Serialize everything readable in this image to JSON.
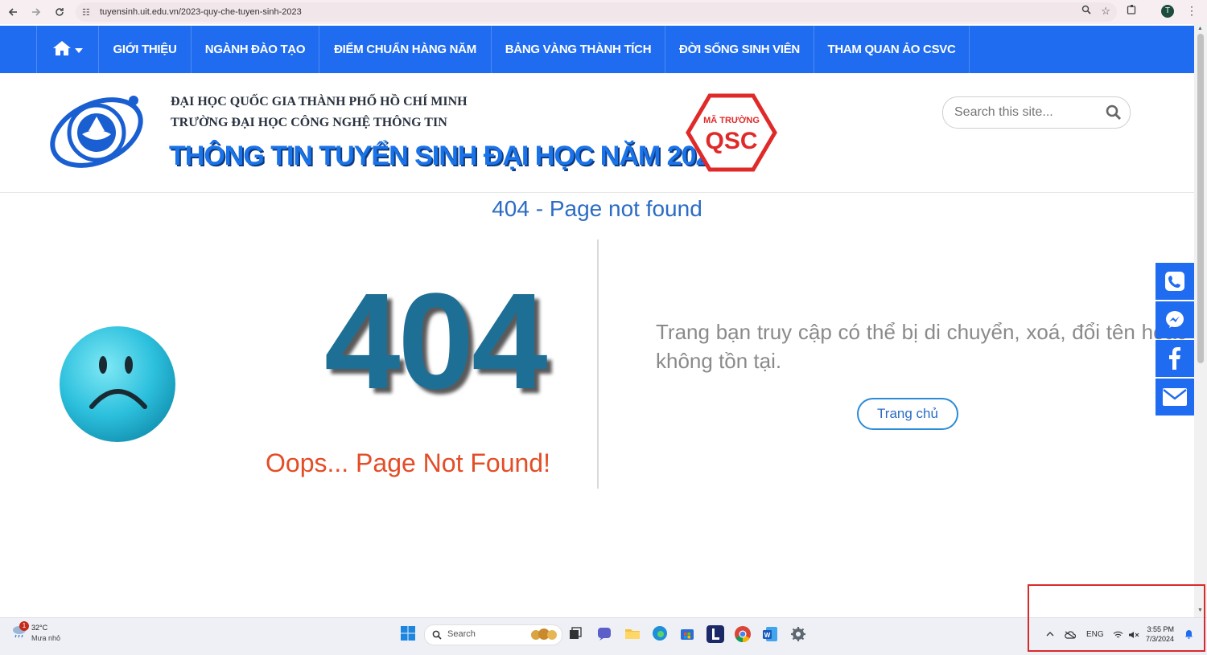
{
  "browser": {
    "url": "tuyensinh.uit.edu.vn/2023-quy-che-tuyen-sinh-2023",
    "profile_initial": "T"
  },
  "menu": {
    "items": [
      {
        "label": "GIỚI THIỆU"
      },
      {
        "label": "NGÀNH ĐÀO TẠO"
      },
      {
        "label": "ĐIỂM CHUẨN HÀNG NĂM"
      },
      {
        "label": "BẢNG VÀNG THÀNH TÍCH"
      },
      {
        "label": "ĐỜI SỐNG SINH VIÊN"
      },
      {
        "label": "THAM QUAN ẢO CSVC"
      }
    ],
    "color": "#1f6cf0"
  },
  "header": {
    "university_line1": "ĐẠI HỌC QUỐC GIA THÀNH PHỐ HỒ CHÍ MINH",
    "university_line2": "TRƯỜNG ĐẠI HỌC CÔNG NGHỆ THÔNG TIN",
    "title": "THÔNG TIN TUYỂN SINH ĐẠI HỌC NĂM 2024",
    "school_code_label": "MÃ TRƯỜNG",
    "school_code": "QSC",
    "search_placeholder": "Search this site..."
  },
  "content": {
    "page_title": "404 - Page not found",
    "big_code": "404",
    "oops": "Oops... Page Not Found!",
    "message": "Trang bạn truy cập có thể bị di chuyển, xoá, đổi tên hoặc không tồn tại.",
    "home_button": "Trang chủ"
  },
  "social": [
    "phone-icon",
    "messenger-icon",
    "facebook-icon",
    "mail-icon"
  ],
  "taskbar": {
    "weather_temp": "32°C",
    "weather_desc": "Mưa nhỏ",
    "weather_badge": "1",
    "search_label": "Search",
    "language": "ENG",
    "time": "3:55 PM",
    "date": "7/3/2024"
  }
}
